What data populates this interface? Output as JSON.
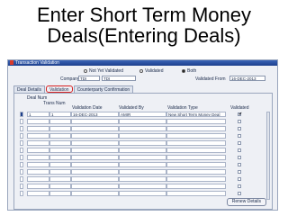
{
  "slide": {
    "title_line1": "Enter Short Term Money",
    "title_line2": "Deals(Entering Deals)"
  },
  "window": {
    "title": "Transaction Validation",
    "radios": [
      {
        "label": "Not Yet Validated",
        "selected": false
      },
      {
        "label": "Validated",
        "selected": false
      },
      {
        "label": "Both",
        "selected": true
      }
    ],
    "company_label": "Company",
    "company_code": "TDI",
    "company_name": "TDI",
    "validated_from_label": "Validated From",
    "validated_from_value": "16-DEC-2013"
  },
  "tabs": [
    {
      "label": "Deal Details",
      "active": false
    },
    {
      "label": "Validation",
      "active": true
    },
    {
      "label": "Counterparty Confirmation",
      "active": false
    }
  ],
  "table": {
    "headers": {
      "deal_num": "Deal Num",
      "trans_num": "Trans Num",
      "validation_date": "Validation Date",
      "validated_by": "Validated By",
      "validation_type": "Validation Type",
      "validated": "Validated"
    },
    "rows": [
      {
        "deal_num": "1",
        "trans_num": "1",
        "validation_date": "16-DEC-2013",
        "validated_by": "AMIR",
        "validation_type": "New Short Term Money Deal",
        "validated": true
      },
      {
        "deal_num": "",
        "trans_num": "",
        "validation_date": "",
        "validated_by": "",
        "validation_type": "",
        "validated": false
      },
      {
        "deal_num": "",
        "trans_num": "",
        "validation_date": "",
        "validated_by": "",
        "validation_type": "",
        "validated": false
      },
      {
        "deal_num": "",
        "trans_num": "",
        "validation_date": "",
        "validated_by": "",
        "validation_type": "",
        "validated": false
      },
      {
        "deal_num": "",
        "trans_num": "",
        "validation_date": "",
        "validated_by": "",
        "validation_type": "",
        "validated": false
      },
      {
        "deal_num": "",
        "trans_num": "",
        "validation_date": "",
        "validated_by": "",
        "validation_type": "",
        "validated": false
      },
      {
        "deal_num": "",
        "trans_num": "",
        "validation_date": "",
        "validated_by": "",
        "validation_type": "",
        "validated": false
      },
      {
        "deal_num": "",
        "trans_num": "",
        "validation_date": "",
        "validated_by": "",
        "validation_type": "",
        "validated": false
      },
      {
        "deal_num": "",
        "trans_num": "",
        "validation_date": "",
        "validated_by": "",
        "validation_type": "",
        "validated": false
      },
      {
        "deal_num": "",
        "trans_num": "",
        "validation_date": "",
        "validated_by": "",
        "validation_type": "",
        "validated": false
      },
      {
        "deal_num": "",
        "trans_num": "",
        "validation_date": "",
        "validated_by": "",
        "validation_type": "",
        "validated": false
      },
      {
        "deal_num": "",
        "trans_num": "",
        "validation_date": "",
        "validated_by": "",
        "validation_type": "",
        "validated": false
      }
    ]
  },
  "buttons": {
    "renew": "Renew Details"
  },
  "colors": {
    "title_bar": "#1d3f8c",
    "active_tab_outline": "#d62020",
    "window_bg": "#eef0f5"
  },
  "icons": {
    "close": "close-icon",
    "scroll": "scrollbar",
    "check": "check-icon"
  }
}
